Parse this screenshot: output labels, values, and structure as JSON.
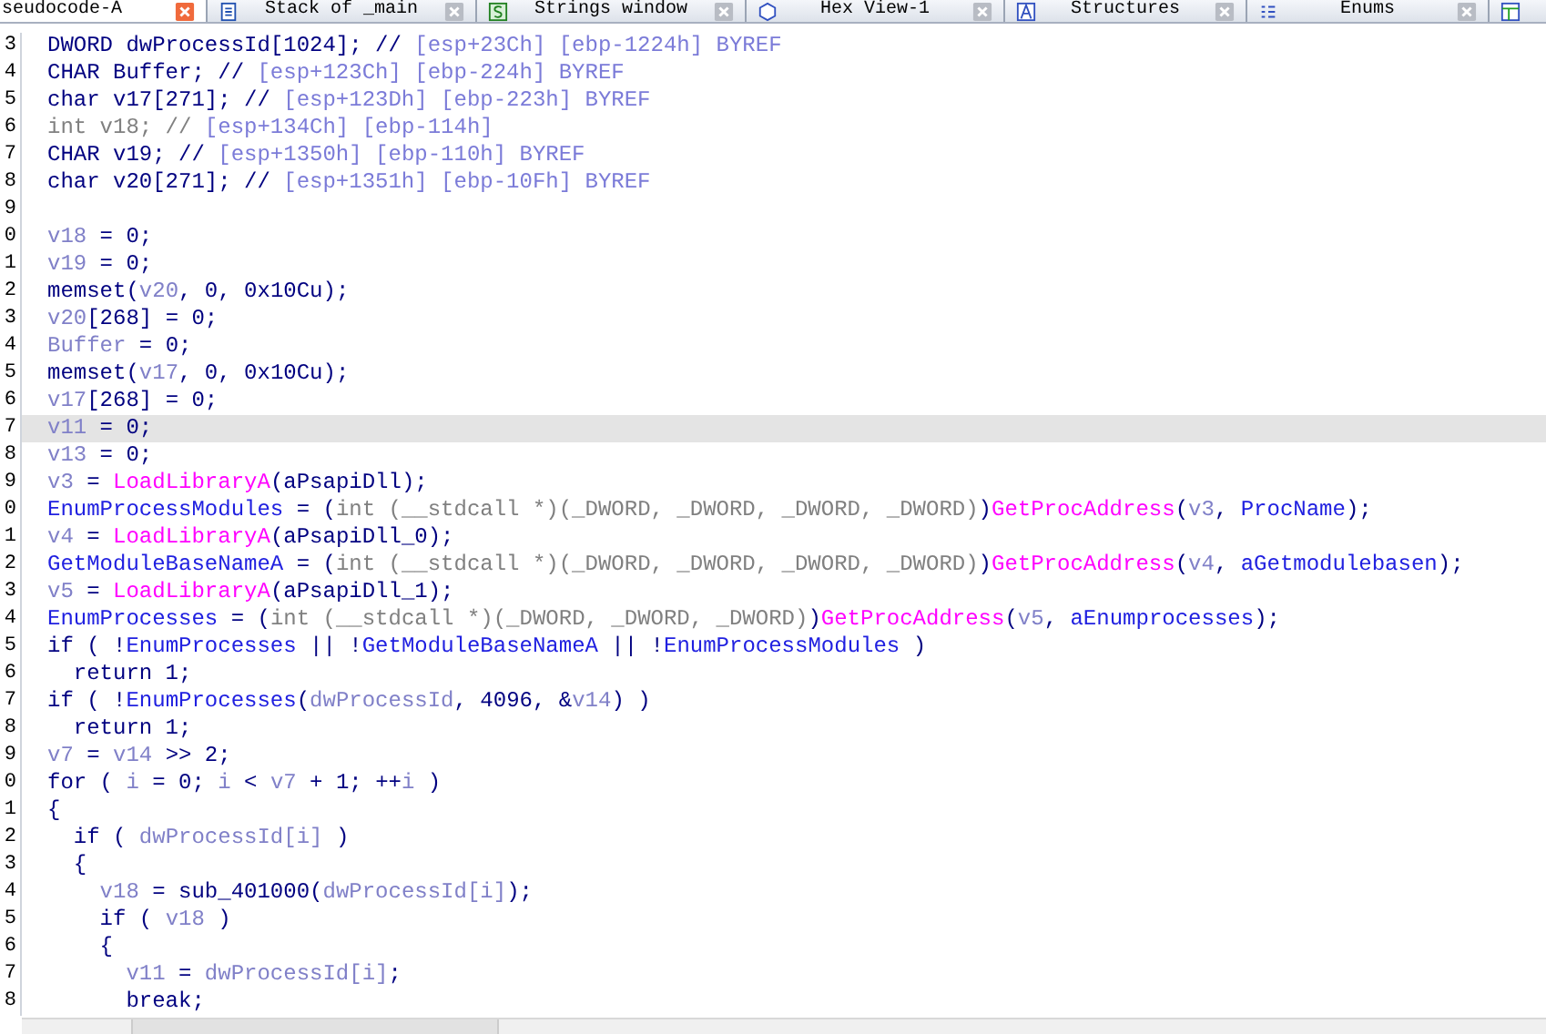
{
  "tabs": [
    {
      "kind": "pseudocode",
      "label": "seudocode-A",
      "selected": true
    },
    {
      "kind": "stack",
      "label": "Stack of _main",
      "selected": false
    },
    {
      "kind": "strings",
      "label": "Strings window",
      "selected": false
    },
    {
      "kind": "hex",
      "label": "Hex View-1",
      "selected": false
    },
    {
      "kind": "structures",
      "label": "Structures",
      "selected": false
    },
    {
      "kind": "enums",
      "label": "Enums",
      "selected": false
    },
    {
      "kind": "other",
      "selected": false
    }
  ],
  "code_lines": [
    {
      "number": "3",
      "selected": false,
      "tokens": [
        {
          "kind": "plain",
          "text": "DWORD dwProcessId[1024]; // "
        },
        {
          "kind": "comment",
          "text": "[esp+23Ch] [ebp-1224h] BYREF"
        }
      ]
    },
    {
      "number": "4",
      "selected": false,
      "tokens": [
        {
          "kind": "plain",
          "text": "CHAR Buffer; // "
        },
        {
          "kind": "comment",
          "text": "[esp+123Ch] [ebp-224h] BYREF"
        }
      ]
    },
    {
      "number": "5",
      "selected": false,
      "tokens": [
        {
          "kind": "plain",
          "text": "char v17[271]; // "
        },
        {
          "kind": "comment",
          "text": "[esp+123Dh] [ebp-223h] BYREF"
        }
      ]
    },
    {
      "number": "6",
      "selected": false,
      "tokens": [
        {
          "kind": "muted",
          "text": "int v18; // "
        },
        {
          "kind": "comment",
          "text": "[esp+134Ch] [ebp-114h]"
        }
      ]
    },
    {
      "number": "7",
      "selected": false,
      "tokens": [
        {
          "kind": "plain",
          "text": "CHAR v19; // "
        },
        {
          "kind": "comment",
          "text": "[esp+1350h] [ebp-110h] BYREF"
        }
      ]
    },
    {
      "number": "8",
      "selected": false,
      "tokens": [
        {
          "kind": "plain",
          "text": "char v20[271]; // "
        },
        {
          "kind": "comment",
          "text": "[esp+1351h] [ebp-10Fh] BYREF"
        }
      ]
    },
    {
      "number": "9",
      "selected": false
    },
    {
      "number": "0",
      "selected": false,
      "tokens": [
        {
          "kind": "local",
          "text": "v18"
        },
        {
          "kind": "plain",
          "text": " = 0;"
        }
      ]
    },
    {
      "number": "1",
      "selected": false,
      "tokens": [
        {
          "kind": "local",
          "text": "v19"
        },
        {
          "kind": "plain",
          "text": " = 0;"
        }
      ]
    },
    {
      "number": "2",
      "selected": false,
      "tokens": [
        {
          "kind": "plain",
          "text": "memset("
        },
        {
          "kind": "local",
          "text": "v20"
        },
        {
          "kind": "plain",
          "text": ", 0, 0x10Cu);"
        }
      ]
    },
    {
      "number": "3",
      "selected": false,
      "tokens": [
        {
          "kind": "local",
          "text": "v20"
        },
        {
          "kind": "plain",
          "text": "[268] = 0;"
        }
      ]
    },
    {
      "number": "4",
      "selected": false,
      "tokens": [
        {
          "kind": "local",
          "text": "Buffer"
        },
        {
          "kind": "plain",
          "text": " = 0;"
        }
      ]
    },
    {
      "number": "5",
      "selected": false,
      "tokens": [
        {
          "kind": "plain",
          "text": "memset("
        },
        {
          "kind": "local",
          "text": "v17"
        },
        {
          "kind": "plain",
          "text": ", 0, 0x10Cu);"
        }
      ]
    },
    {
      "number": "6",
      "selected": false,
      "tokens": [
        {
          "kind": "local",
          "text": "v17"
        },
        {
          "kind": "plain",
          "text": "[268] = 0;"
        }
      ]
    },
    {
      "number": "7",
      "selected": true,
      "tokens": [
        {
          "kind": "local",
          "text": "v11"
        },
        {
          "kind": "plain",
          "text": " = 0;"
        }
      ]
    },
    {
      "number": "8",
      "selected": false,
      "tokens": [
        {
          "kind": "local",
          "text": "v13"
        },
        {
          "kind": "plain",
          "text": " = 0;"
        }
      ]
    },
    {
      "number": "9",
      "selected": false,
      "tokens": [
        {
          "kind": "local",
          "text": "v3"
        },
        {
          "kind": "plain",
          "text": " = "
        },
        {
          "kind": "func",
          "text": "LoadLibraryA"
        },
        {
          "kind": "plain",
          "text": "(aPsapiDll);"
        }
      ]
    },
    {
      "number": "0",
      "selected": false,
      "tokens": [
        {
          "kind": "global",
          "text": "EnumProcessModules"
        },
        {
          "kind": "plain",
          "text": " = ("
        },
        {
          "kind": "muted",
          "text": "int (__stdcall *)(_DWORD, _DWORD, _DWORD, _DWORD)"
        },
        {
          "kind": "plain",
          "text": ")"
        },
        {
          "kind": "func",
          "text": "GetProcAddress"
        },
        {
          "kind": "plain",
          "text": "("
        },
        {
          "kind": "local",
          "text": "v3"
        },
        {
          "kind": "plain",
          "text": ", "
        },
        {
          "kind": "global",
          "text": "ProcName"
        },
        {
          "kind": "plain",
          "text": ");"
        }
      ]
    },
    {
      "number": "1",
      "selected": false,
      "tokens": [
        {
          "kind": "local",
          "text": "v4"
        },
        {
          "kind": "plain",
          "text": " = "
        },
        {
          "kind": "func",
          "text": "LoadLibraryA"
        },
        {
          "kind": "plain",
          "text": "(aPsapiDll_0);"
        }
      ]
    },
    {
      "number": "2",
      "selected": false,
      "tokens": [
        {
          "kind": "global",
          "text": "GetModuleBaseNameA"
        },
        {
          "kind": "plain",
          "text": " = ("
        },
        {
          "kind": "muted",
          "text": "int (__stdcall *)(_DWORD, _DWORD, _DWORD, _DWORD)"
        },
        {
          "kind": "plain",
          "text": ")"
        },
        {
          "kind": "func",
          "text": "GetProcAddress"
        },
        {
          "kind": "plain",
          "text": "("
        },
        {
          "kind": "local",
          "text": "v4"
        },
        {
          "kind": "plain",
          "text": ", "
        },
        {
          "kind": "global",
          "text": "aGetmodulebasen"
        },
        {
          "kind": "plain",
          "text": ");"
        }
      ]
    },
    {
      "number": "3",
      "selected": false,
      "tokens": [
        {
          "kind": "local",
          "text": "v5"
        },
        {
          "kind": "plain",
          "text": " = "
        },
        {
          "kind": "func",
          "text": "LoadLibraryA"
        },
        {
          "kind": "plain",
          "text": "(aPsapiDll_1);"
        }
      ]
    },
    {
      "number": "4",
      "selected": false,
      "tokens": [
        {
          "kind": "global",
          "text": "EnumProcesses"
        },
        {
          "kind": "plain",
          "text": " = ("
        },
        {
          "kind": "muted",
          "text": "int (__stdcall *)(_DWORD, _DWORD, _DWORD)"
        },
        {
          "kind": "plain",
          "text": ")"
        },
        {
          "kind": "func",
          "text": "GetProcAddress"
        },
        {
          "kind": "plain",
          "text": "("
        },
        {
          "kind": "local",
          "text": "v5"
        },
        {
          "kind": "plain",
          "text": ", "
        },
        {
          "kind": "global",
          "text": "aEnumprocesses"
        },
        {
          "kind": "plain",
          "text": ");"
        }
      ]
    },
    {
      "number": "5",
      "selected": false,
      "tokens": [
        {
          "kind": "plain",
          "text": "if ( !"
        },
        {
          "kind": "global",
          "text": "EnumProcesses"
        },
        {
          "kind": "plain",
          "text": " || !"
        },
        {
          "kind": "global",
          "text": "GetModuleBaseNameA"
        },
        {
          "kind": "plain",
          "text": " || !"
        },
        {
          "kind": "global",
          "text": "EnumProcessModules"
        },
        {
          "kind": "plain",
          "text": " )"
        }
      ]
    },
    {
      "number": "6",
      "selected": false,
      "tokens": [
        {
          "kind": "plain",
          "text": "  return 1;"
        }
      ]
    },
    {
      "number": "7",
      "selected": false,
      "tokens": [
        {
          "kind": "plain",
          "text": "if ( !"
        },
        {
          "kind": "global",
          "text": "EnumProcesses"
        },
        {
          "kind": "plain",
          "text": "("
        },
        {
          "kind": "local",
          "text": "dwProcessId"
        },
        {
          "kind": "plain",
          "text": ", 4096, &"
        },
        {
          "kind": "local",
          "text": "v14"
        },
        {
          "kind": "plain",
          "text": ") )"
        }
      ]
    },
    {
      "number": "8",
      "selected": false,
      "tokens": [
        {
          "kind": "plain",
          "text": "  return 1;"
        }
      ]
    },
    {
      "number": "9",
      "selected": false,
      "tokens": [
        {
          "kind": "local",
          "text": "v7"
        },
        {
          "kind": "plain",
          "text": " = "
        },
        {
          "kind": "local",
          "text": "v14"
        },
        {
          "kind": "plain",
          "text": " >> 2;"
        }
      ]
    },
    {
      "number": "0",
      "selected": false,
      "tokens": [
        {
          "kind": "plain",
          "text": "for ( "
        },
        {
          "kind": "local",
          "text": "i"
        },
        {
          "kind": "plain",
          "text": " = 0; "
        },
        {
          "kind": "local",
          "text": "i"
        },
        {
          "kind": "plain",
          "text": " < "
        },
        {
          "kind": "local",
          "text": "v7"
        },
        {
          "kind": "plain",
          "text": " + 1; ++"
        },
        {
          "kind": "local",
          "text": "i"
        },
        {
          "kind": "plain",
          "text": " )"
        }
      ]
    },
    {
      "number": "1",
      "selected": false,
      "tokens": [
        {
          "kind": "plain",
          "text": "{"
        }
      ]
    },
    {
      "number": "2",
      "selected": false,
      "tokens": [
        {
          "kind": "plain",
          "text": "  if ( "
        },
        {
          "kind": "local",
          "text": "dwProcessId[i]"
        },
        {
          "kind": "plain",
          "text": " )"
        }
      ]
    },
    {
      "number": "3",
      "selected": false,
      "tokens": [
        {
          "kind": "plain",
          "text": "  {"
        }
      ]
    },
    {
      "number": "4",
      "selected": false,
      "tokens": [
        {
          "kind": "local",
          "text": "    v18"
        },
        {
          "kind": "plain",
          "text": " = sub_401000("
        },
        {
          "kind": "local",
          "text": "dwProcessId[i]"
        },
        {
          "kind": "plain",
          "text": ");"
        }
      ]
    },
    {
      "number": "5",
      "selected": false,
      "tokens": [
        {
          "kind": "plain",
          "text": "    if ( "
        },
        {
          "kind": "local",
          "text": "v18"
        },
        {
          "kind": "plain",
          "text": " )"
        }
      ]
    },
    {
      "number": "6",
      "selected": false,
      "tokens": [
        {
          "kind": "plain",
          "text": "    {"
        }
      ]
    },
    {
      "number": "7",
      "selected": false,
      "tokens": [
        {
          "kind": "local",
          "text": "      v11"
        },
        {
          "kind": "plain",
          "text": " = "
        },
        {
          "kind": "local",
          "text": "dwProcessId[i]"
        },
        {
          "kind": "plain",
          "text": ";"
        }
      ]
    },
    {
      "number": "8",
      "selected": false,
      "tokens": [
        {
          "kind": "plain",
          "text": "      break;"
        }
      ]
    }
  ]
}
